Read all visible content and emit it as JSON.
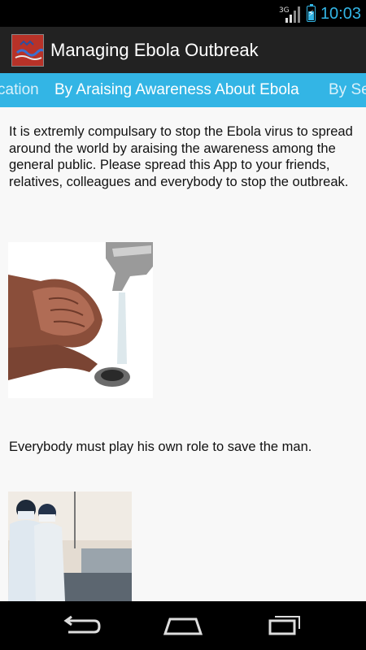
{
  "status_bar": {
    "network_type": "3G",
    "time": "10:03",
    "battery_level": 0.6,
    "icons": [
      "signal-icon",
      "battery-charging-icon"
    ]
  },
  "action_bar": {
    "title": "Managing Ebola Outbreak",
    "icon": "app-logo-icon"
  },
  "tabs": [
    {
      "label": "cation",
      "active": false
    },
    {
      "label": "By Araising Awareness About Ebola",
      "active": true
    },
    {
      "label": "By Se",
      "active": false
    }
  ],
  "content": {
    "paragraph1": "It is extremly compulsary to stop the Ebola virus to spread around the world by araising the awareness among the general public. Please spread this App to your friends, relatives, colleagues and everybody to stop the outbreak.",
    "paragraph2": "Everybody must play his own role to save the man."
  },
  "nav_bar": {
    "icons": [
      "back-icon",
      "home-icon",
      "recent-apps-icon"
    ]
  },
  "colors": {
    "accent": "#33b5e5",
    "action_bar_bg": "#222222",
    "content_bg": "#f8f8f8"
  }
}
